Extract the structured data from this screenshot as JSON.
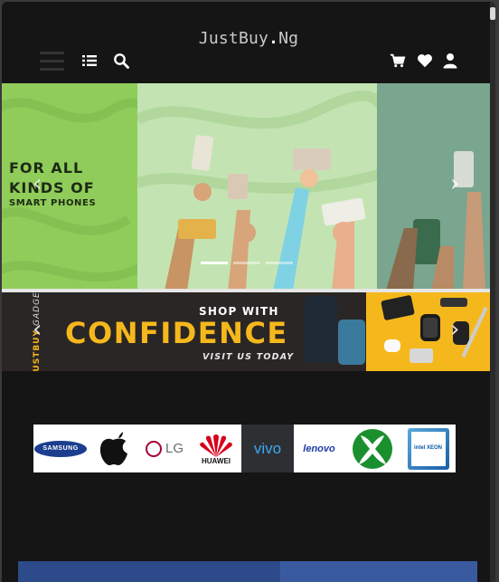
{
  "header": {
    "logo_prefix": "JustBuy",
    "logo_dot": ".",
    "logo_suffix": "Ng",
    "icons": [
      "menu-icon",
      "list-icon",
      "search-icon",
      "cart-icon",
      "heart-icon",
      "user-icon"
    ]
  },
  "hero": {
    "line1": "FOR ALL",
    "line2": "KINDS OF",
    "line3": "SMART PHONES",
    "prev_arrow": "‹",
    "next_arrow": "›",
    "slide_count": 3,
    "active_slide": 1
  },
  "banner": {
    "brand": "JUSTBUY",
    "brand_sub": "GADGETS",
    "shop_with": "SHOP WITH",
    "headline": "CONFIDENCE",
    "visit": "VISIT US TODAY",
    "prev_arrow": "‹",
    "next_arrow": "›"
  },
  "brands": [
    {
      "name": "SAMSUNG"
    },
    {
      "name": "apple"
    },
    {
      "name": "LG"
    },
    {
      "name": "HUAWEI"
    },
    {
      "name": "vivo"
    },
    {
      "name": "lenovo"
    },
    {
      "name": "xbox"
    },
    {
      "name": "intel XEON"
    }
  ],
  "colors": {
    "background": "#151515",
    "accent_yellow": "#f5b81c",
    "hero_green": "#8fcc5a"
  }
}
